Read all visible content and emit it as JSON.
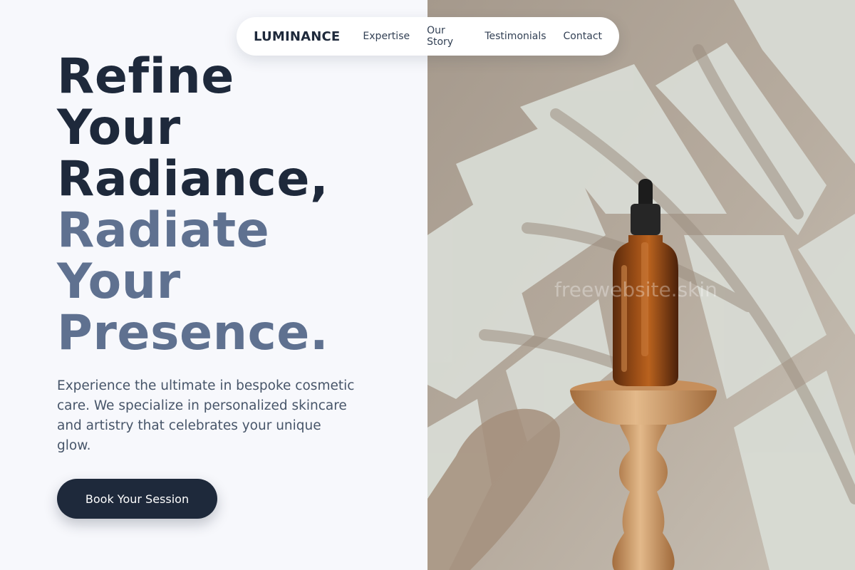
{
  "nav": {
    "brand": "LUMINANCE",
    "links": [
      "Expertise",
      "Our Story",
      "Testimonials",
      "Contact"
    ]
  },
  "hero": {
    "headline_dark": [
      "Refine",
      "Your",
      "Radiance,"
    ],
    "headline_muted": [
      "Radiate",
      "Your",
      "Presence."
    ],
    "description": "Experience the ultimate in bespoke cosmetic care. We specialize in personalized skincare and artistry that celebrates your unique glow.",
    "cta_label": "Book Your Session"
  },
  "watermark": "freewebsite.skin",
  "colors": {
    "primary": "#1e293b",
    "headline_muted": "#5f7190",
    "body_text": "#475569",
    "page_background": "#f7f8fc"
  }
}
